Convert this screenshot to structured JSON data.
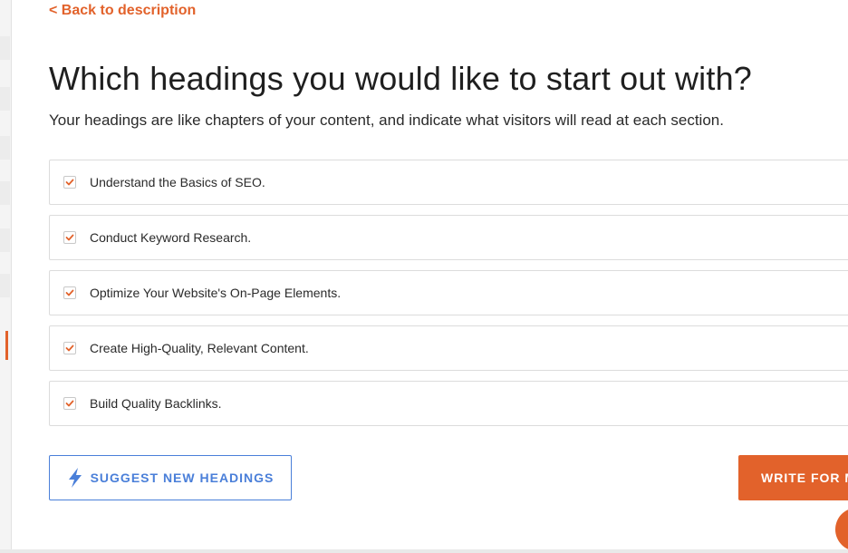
{
  "back_link": {
    "label": "< Back to description"
  },
  "title": "Which headings you would like to start out with?",
  "subtitle": "Your headings are like chapters of your content, and indicate what visitors will read at each section.",
  "headings": [
    {
      "label": "Understand the Basics of SEO.",
      "checked": true
    },
    {
      "label": "Conduct Keyword Research.",
      "checked": true
    },
    {
      "label": "Optimize Your Website's On-Page Elements.",
      "checked": true
    },
    {
      "label": "Create High-Quality, Relevant Content.",
      "checked": true
    },
    {
      "label": "Build Quality Backlinks.",
      "checked": true
    }
  ],
  "suggest_button": {
    "label": "SUGGEST NEW HEADINGS",
    "icon": "lightning-bolt-icon"
  },
  "write_button": {
    "label": "WRITE FOR M"
  },
  "colors": {
    "accent": "#e2622b",
    "primary_blue": "#4a7fd9",
    "check": "#e2622b"
  }
}
